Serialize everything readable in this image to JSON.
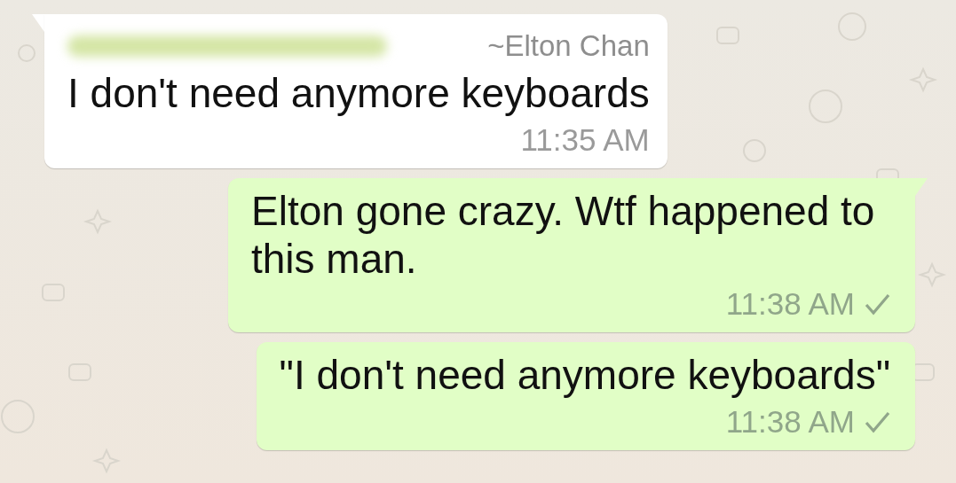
{
  "messages": [
    {
      "kind": "incoming",
      "tail": true,
      "sender_hidden": true,
      "sender_name": "~Elton Chan",
      "text": "I don't need anymore keyboards",
      "time": "11:35 AM"
    },
    {
      "kind": "outgoing",
      "tail": true,
      "text": "Elton gone crazy. Wtf happened to this man.",
      "time": "11:38 AM",
      "sent": true
    },
    {
      "kind": "outgoing",
      "tail": false,
      "text": "\"I don't need anymore keyboards\"",
      "time": "11:38 AM",
      "sent": true
    }
  ]
}
